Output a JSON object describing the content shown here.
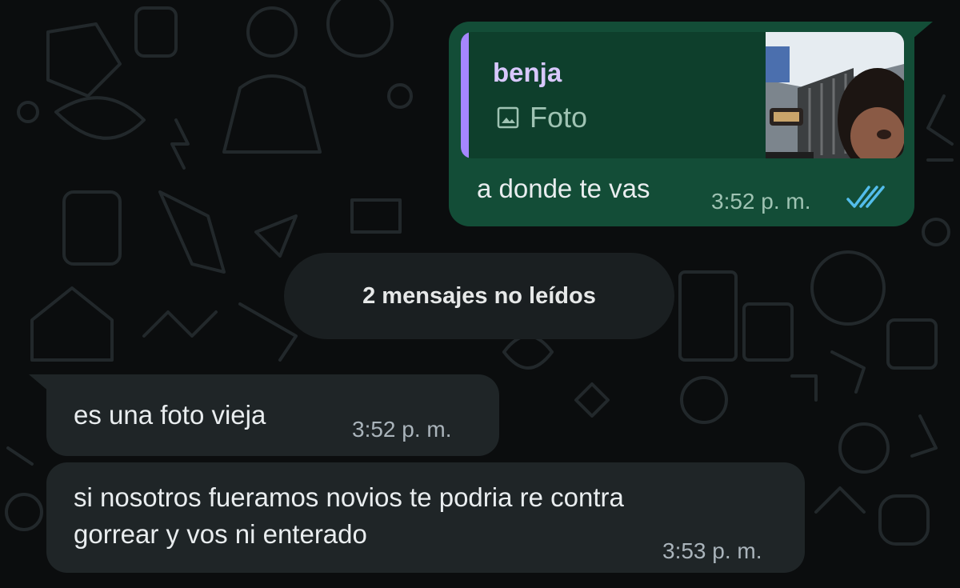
{
  "outgoing_message": {
    "quote_author": "benja",
    "quote_type": "Foto",
    "quote_icon": "image-icon",
    "text": "a donde te vas",
    "time": "3:52 p. m.",
    "status_icon": "double-check-read-icon",
    "status_color": "#53bdeb"
  },
  "unread_divider": "2 mensajes no leídos",
  "incoming_messages": [
    {
      "text": "es una foto vieja",
      "time": "3:52 p. m."
    },
    {
      "text_line1": "si nosotros fueramos novios te podria re contra",
      "text_line2": "gorrear y vos ni enterado",
      "time": "3:53 p. m."
    }
  ],
  "colors": {
    "background": "#0b0d0e",
    "outgoing_bubble": "#134d37",
    "incoming_bubble": "#1f2527",
    "quote_accent": "#a586ff"
  }
}
